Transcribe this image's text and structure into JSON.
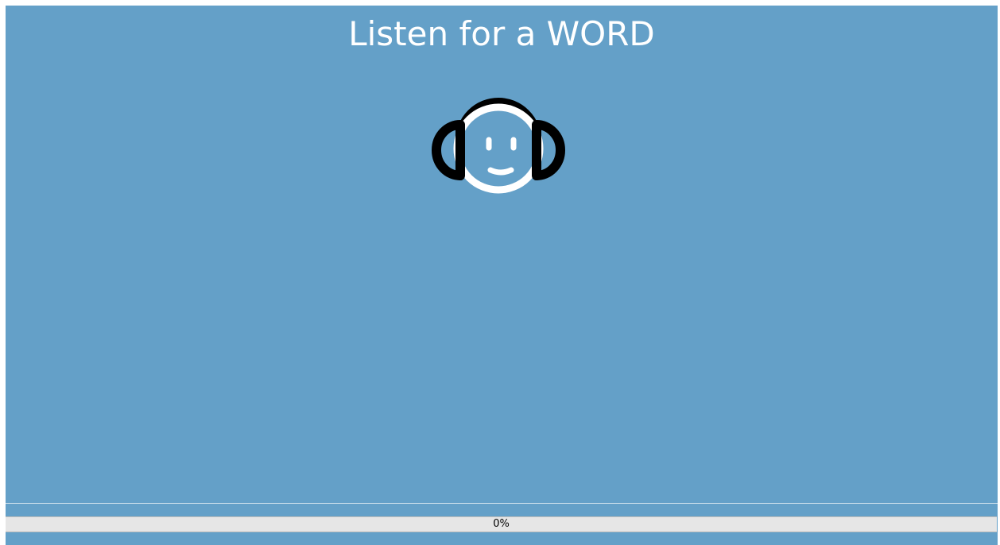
{
  "header": {
    "title": "Listen for a WORD"
  },
  "listener": {
    "icon": "headphones-smiley-icon"
  },
  "progress": {
    "value_percent": 0,
    "label": "0%"
  },
  "colors": {
    "background": "#64a0c8",
    "title_text": "#ffffff",
    "progress_track": "#e6e6e6"
  }
}
